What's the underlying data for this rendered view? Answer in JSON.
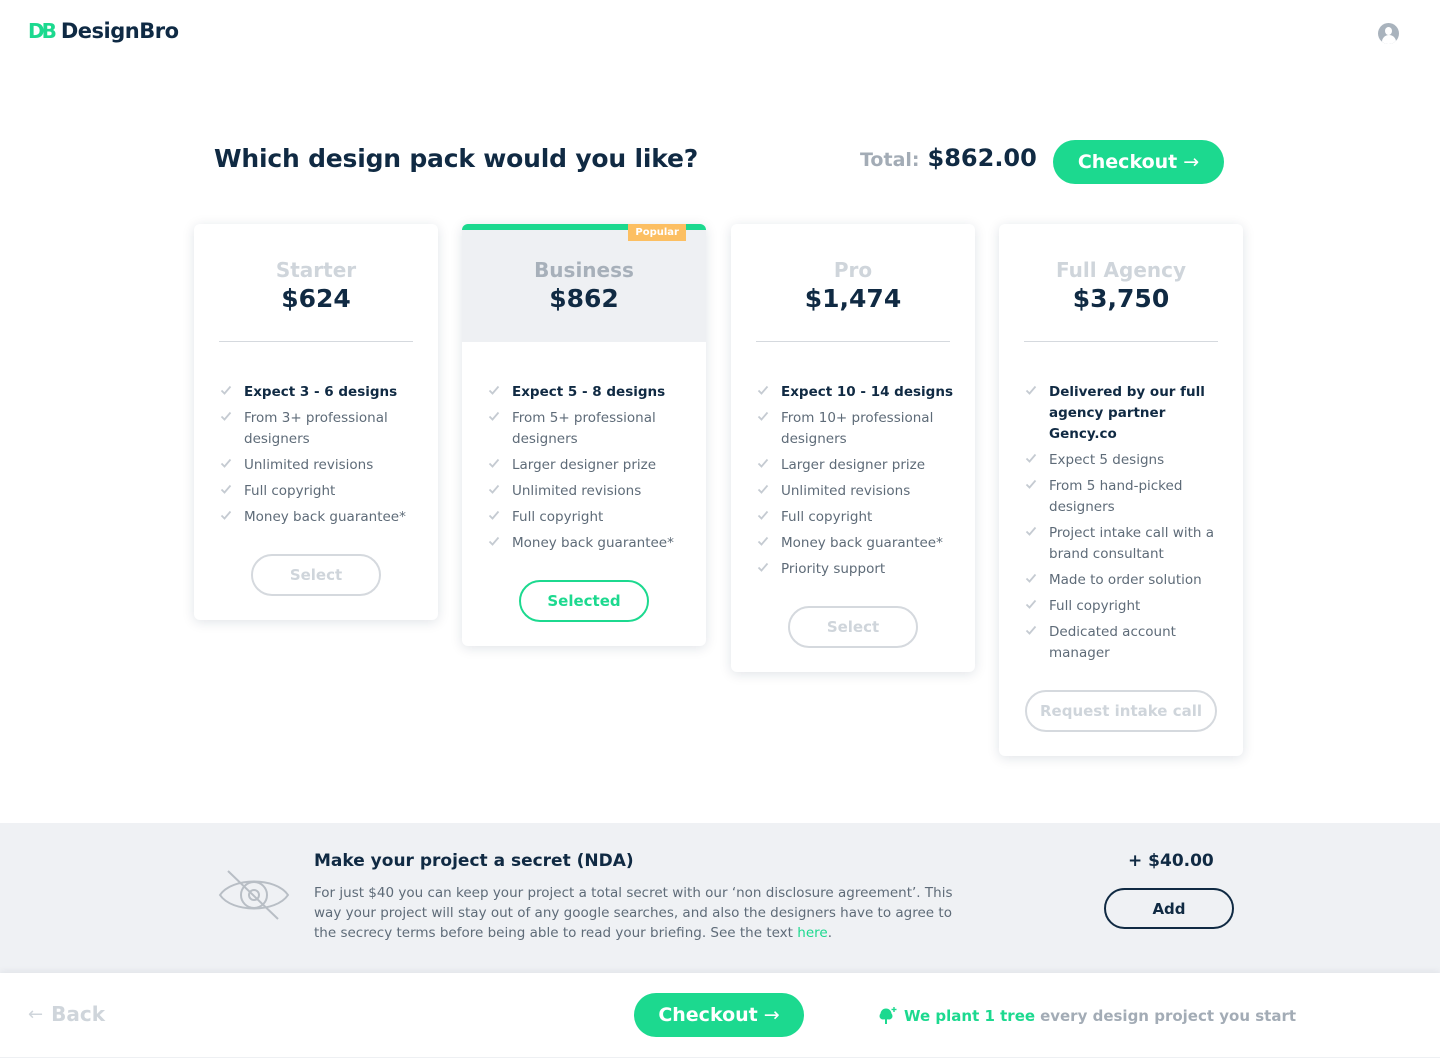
{
  "header": {
    "logo_mark": "DB",
    "logo_text": "DesignBro",
    "avatar_icon": "user-avatar-icon"
  },
  "title_row": {
    "title": "Which design pack would you like?",
    "total_label": "Total:",
    "total_value": "$862.00",
    "checkout_label": "Checkout",
    "checkout_arrow": "→"
  },
  "plans": [
    {
      "name": "Starter",
      "price": "$624",
      "selected": false,
      "badge": null,
      "features": [
        {
          "text": "Expect 3 - 6 designs",
          "bold": true
        },
        {
          "text": "From 3+ professional designers",
          "bold": false
        },
        {
          "text": "Unlimited revisions",
          "bold": false
        },
        {
          "text": "Full copyright",
          "bold": false
        },
        {
          "text": "Money back guarantee*",
          "bold": false
        }
      ],
      "button_label": "Select"
    },
    {
      "name": "Business",
      "price": "$862",
      "selected": true,
      "badge": "Popular",
      "features": [
        {
          "text": "Expect 5 - 8 designs",
          "bold": true
        },
        {
          "text": "From 5+ professional designers",
          "bold": false
        },
        {
          "text": "Larger designer prize",
          "bold": false
        },
        {
          "text": "Unlimited revisions",
          "bold": false
        },
        {
          "text": "Full copyright",
          "bold": false
        },
        {
          "text": "Money back guarantee*",
          "bold": false
        }
      ],
      "button_label": "Selected"
    },
    {
      "name": "Pro",
      "price": "$1,474",
      "selected": false,
      "badge": null,
      "features": [
        {
          "text": "Expect 10 - 14 designs",
          "bold": true
        },
        {
          "text": "From 10+ professional designers",
          "bold": false
        },
        {
          "text": "Larger designer prize",
          "bold": false
        },
        {
          "text": "Unlimited revisions",
          "bold": false
        },
        {
          "text": "Full copyright",
          "bold": false
        },
        {
          "text": "Money back guarantee*",
          "bold": false
        },
        {
          "text": "Priority support",
          "bold": false
        }
      ],
      "button_label": "Select"
    },
    {
      "name": "Full Agency",
      "price": "$3,750",
      "selected": false,
      "badge": null,
      "features": [
        {
          "text": "Delivered by our full agency partner Gency.co",
          "bold": true
        },
        {
          "text": "Expect 5 designs",
          "bold": false
        },
        {
          "text": "From 5 hand-picked designers",
          "bold": false
        },
        {
          "text": "Project intake call with a brand consultant",
          "bold": false
        },
        {
          "text": "Made to order solution",
          "bold": false
        },
        {
          "text": "Full copyright",
          "bold": false
        },
        {
          "text": "Dedicated account manager",
          "bold": false
        }
      ],
      "button_label": "Request intake call"
    }
  ],
  "nda": {
    "icon": "eye-slash-icon",
    "title": "Make your project a secret (NDA)",
    "text_before_link": "For just $40 you can keep your project a total secret with our ‘non disclosure agreement’. This way your project will stay out of any google searches, and also the designers have to agree to the secrecy terms before being able to read your briefing. See the text ",
    "link_text": "here",
    "text_after_link": ".",
    "price": "+ $40.00",
    "add_label": "Add"
  },
  "footer": {
    "back_arrow": "←",
    "back_label": "Back",
    "checkout_label": "Checkout",
    "checkout_arrow": "→",
    "tree_icon": "tree-icon",
    "tree_highlight": "We plant 1 tree",
    "tree_rest": "every design project you start"
  },
  "colors": {
    "brand_green": "#1cd98f",
    "navy": "#102a43",
    "muted_grey": "#a3acb6",
    "badge_orange": "#fcbf62",
    "nda_background": "#eff1f4"
  }
}
